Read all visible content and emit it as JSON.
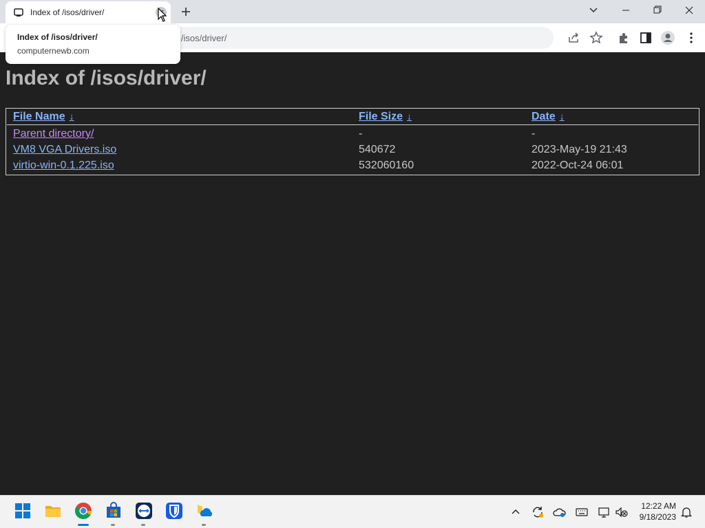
{
  "browser": {
    "tab_title": "Index of /isos/driver/",
    "address_partial": "i/isos/driver/",
    "tooltip": {
      "title": "Index of /isos/driver/",
      "host": "computernewb.com"
    }
  },
  "page": {
    "heading": "Index of /isos/driver/",
    "columns": [
      {
        "label": "File Name",
        "sort": "↓"
      },
      {
        "label": "File Size",
        "sort": "↓"
      },
      {
        "label": "Date",
        "sort": "↓"
      }
    ],
    "rows": [
      {
        "name": "Parent directory/",
        "size": "-",
        "date": "-"
      },
      {
        "name": "VM8 VGA Drivers.iso",
        "size": "540672",
        "date": "2023-May-19 21:43"
      },
      {
        "name": "virtio-win-0.1.225.iso",
        "size": "532060160",
        "date": "2022-Oct-24 06:01"
      }
    ]
  },
  "taskbar": {
    "apps": [
      "start-icon",
      "file-explorer-icon",
      "chrome-icon",
      "store-icon",
      "teamviewer-icon",
      "bitwarden-icon",
      "onedrive-folder-icon"
    ],
    "time": "12:22 AM",
    "date": "9/18/2023"
  },
  "colors": {
    "page_background": "#202020",
    "link": "#8ab4f8",
    "visited_link": "#c58af9",
    "heading": "#b8b8b8"
  }
}
